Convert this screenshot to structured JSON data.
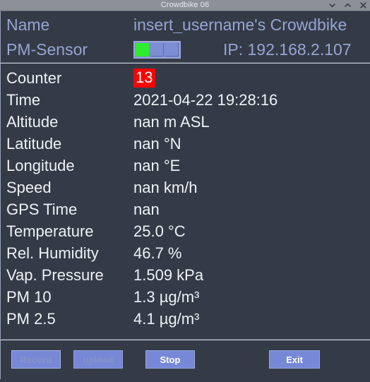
{
  "window": {
    "title": "Crowdbike 06",
    "controls": [
      {
        "name": "minimize",
        "glyph": "chevron-down"
      },
      {
        "name": "maximize",
        "glyph": "chevron-up"
      },
      {
        "name": "close",
        "glyph": "x"
      }
    ]
  },
  "header": {
    "name_label": "Name",
    "name_value": "insert_username's Crowdbike",
    "sensor_label": "PM-Sensor",
    "sensor_segments": [
      true,
      false,
      false
    ],
    "ip_text": "IP: 192.168.2.107"
  },
  "readings": [
    {
      "label": "Counter",
      "value": "13",
      "alert": true
    },
    {
      "label": "Time",
      "value": "2021-04-22 19:28:16",
      "alert": false
    },
    {
      "label": "Altitude",
      "value": "nan m ASL",
      "alert": false
    },
    {
      "label": "Latitude",
      "value": "nan °N",
      "alert": false
    },
    {
      "label": "Longitude",
      "value": "nan °E",
      "alert": false
    },
    {
      "label": "Speed",
      "value": "nan km/h",
      "alert": false
    },
    {
      "label": "GPS Time",
      "value": "nan",
      "alert": false
    },
    {
      "label": "Temperature",
      "value": "25.0 °C",
      "alert": false
    },
    {
      "label": "Rel. Humidity",
      "value": "46.7 %",
      "alert": false
    },
    {
      "label": "Vap. Pressure",
      "value": "1.509 kPa",
      "alert": false
    },
    {
      "label": "PM 10",
      "value": "1.3 µg/m³",
      "alert": false
    },
    {
      "label": "PM 2.5",
      "value": "4.1 µg/m³",
      "alert": false
    }
  ],
  "buttons": {
    "record": {
      "label": "Record",
      "enabled": false
    },
    "upload": {
      "label": "upload",
      "enabled": false
    },
    "stop": {
      "label": "Stop",
      "enabled": true
    },
    "exit": {
      "label": "Exit",
      "enabled": true
    }
  },
  "colors": {
    "window_bg": "#343b47",
    "titlebar_bg": "#8c9199",
    "accent_text": "#97a4d3",
    "body_text": "#eef1f5",
    "alert_bg": "#fe0000",
    "button_bg": "#7688d6",
    "sensor_on": "#2eec2e"
  }
}
